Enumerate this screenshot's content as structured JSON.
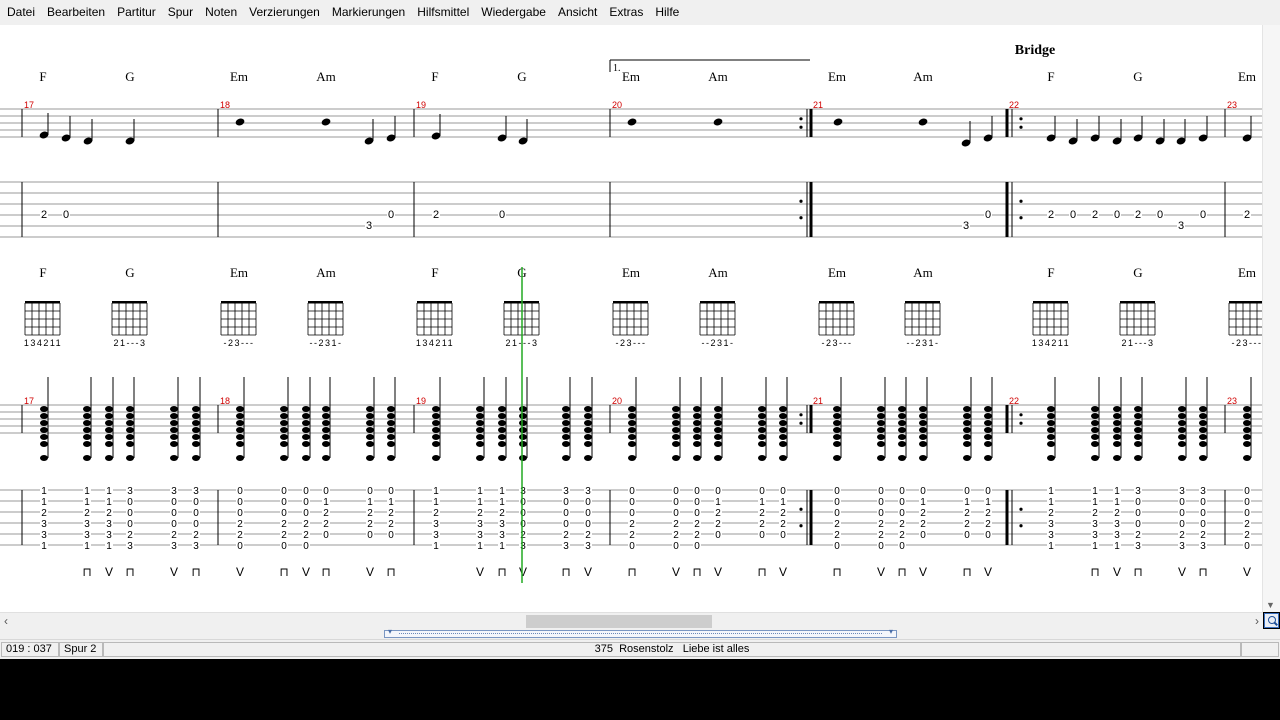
{
  "menu": {
    "items": [
      "Datei",
      "Bearbeiten",
      "Partitur",
      "Spur",
      "Noten",
      "Verzierungen",
      "Markierungen",
      "Hilfsmittel",
      "Wiedergabe",
      "Ansicht",
      "Extras",
      "Hilfe"
    ]
  },
  "score": {
    "section_label": "Bridge",
    "volta_label": "1.",
    "chord_row": [
      "F",
      "G",
      "Em",
      "Am",
      "F",
      "G",
      "Em",
      "Am",
      "Em",
      "Am",
      "F",
      "G",
      "Em"
    ],
    "bar_numbers": [
      "17",
      "18",
      "19",
      "20",
      "21",
      "22",
      "23"
    ],
    "chord_diagrams": [
      {
        "name": "F",
        "fingering": "134211"
      },
      {
        "name": "G",
        "fingering": "21---3"
      },
      {
        "name": "Em",
        "fingering": "-23---"
      },
      {
        "name": "Am",
        "fingering": "--231-"
      },
      {
        "name": "F",
        "fingering": "134211"
      },
      {
        "name": "G",
        "fingering": "21---3"
      },
      {
        "name": "Em",
        "fingering": "-23---"
      },
      {
        "name": "Am",
        "fingering": "--231-"
      },
      {
        "name": "Em",
        "fingering": "-23---"
      },
      {
        "name": "Am",
        "fingering": "--231-"
      },
      {
        "name": "F",
        "fingering": "134211"
      },
      {
        "name": "G",
        "fingering": "21---3"
      },
      {
        "name": "Em",
        "fingering": "-23---"
      }
    ],
    "melody_tab": [
      "2",
      "0",
      "3",
      "0",
      "2",
      "0",
      "3",
      "0",
      "2",
      "0",
      "2",
      "0",
      "2",
      "0",
      "3",
      "0",
      "2"
    ],
    "chord_tab_columns": {
      "F": [
        "1",
        "1",
        "2",
        "3",
        "3",
        "1"
      ],
      "G": [
        "3",
        "0",
        "0",
        "0",
        "2",
        "3"
      ],
      "Em": [
        "0",
        "0",
        "0",
        "2",
        "2",
        "0"
      ],
      "Am": [
        "0",
        "1",
        "2",
        "2",
        "0",
        ""
      ]
    },
    "strum_pattern": [
      "⊓",
      "V"
    ]
  },
  "statusbar": {
    "position": "019 : 037",
    "track": "Spur 2",
    "song_number": "375",
    "artist": "Rosenstolz",
    "title": "Liebe ist alles"
  }
}
